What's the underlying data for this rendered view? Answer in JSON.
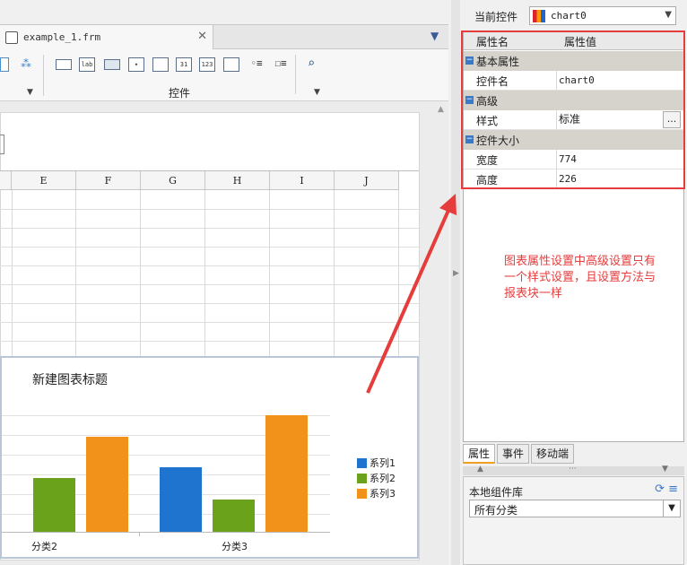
{
  "editor": {
    "tab_name": "example_1.frm",
    "toolbar_group_label": "控件",
    "toolbar_icons": [
      "ab-label-icon",
      "button-icon",
      "combo-icon",
      "form-icon",
      "date-icon",
      "number-icon",
      "table-icon",
      "radio-icon",
      "checkbox-icon",
      "search-icon"
    ],
    "toolbar_icon_text": {
      "label": "lab",
      "date": "31",
      "number": "123"
    },
    "columns": [
      "E",
      "F",
      "G",
      "H",
      "I",
      "J"
    ]
  },
  "chart": {
    "title": "新建图表标题",
    "colors": [
      "#1f74d0",
      "#6aa21b",
      "#f2921a"
    ],
    "chart_data": {
      "type": "bar",
      "categories": [
        "分类2",
        "分类3"
      ],
      "series": [
        {
          "name": "系列1",
          "values": [
            null,
            72
          ]
        },
        {
          "name": "系列2",
          "values": [
            60,
            36
          ]
        },
        {
          "name": "系列3",
          "values": [
            106,
            130
          ]
        }
      ],
      "legend_position": "right"
    }
  },
  "panel": {
    "current_control_label": "当前控件",
    "current_control_value": "chart0",
    "header_name": "属性名",
    "header_value": "属性值",
    "groups": [
      {
        "title": "基本属性",
        "rows": [
          {
            "key": "控件名",
            "value": "chart0"
          }
        ]
      },
      {
        "title": "高级",
        "rows": [
          {
            "key": "样式",
            "value": "标准",
            "button": "..."
          }
        ]
      },
      {
        "title": "控件大小",
        "rows": [
          {
            "key": "宽度",
            "value": "774"
          },
          {
            "key": "高度",
            "value": "226"
          }
        ]
      }
    ],
    "annotation": "图表属性设置中高级设置只有一个样式设置，且设置方法与报表块一样",
    "annotation_color": "#e63c3c",
    "tabs": [
      "属性",
      "事件",
      "移动端"
    ],
    "library_title": "本地组件库",
    "library_filter": "所有分类"
  }
}
